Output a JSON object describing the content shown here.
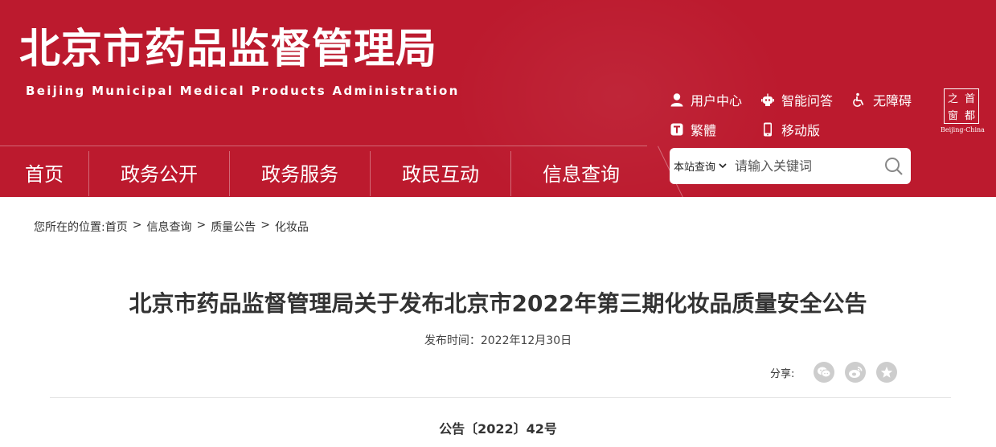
{
  "header": {
    "title": "北京市药品监督管理局",
    "subtitle": "Beijing Municipal Medical Products Administration",
    "links": [
      {
        "label": "用户中心",
        "icon": "user-icon"
      },
      {
        "label": "智能问答",
        "icon": "robot-icon"
      },
      {
        "label": "无障碍",
        "icon": "accessibility-icon"
      },
      {
        "label": "繁體",
        "icon": "traditional-chinese-icon"
      },
      {
        "label": "移动版",
        "icon": "mobile-icon"
      }
    ],
    "capital_logo": {
      "chars": [
        "之",
        "首",
        "窗",
        "都"
      ],
      "caption": "Beijing-China"
    }
  },
  "nav": {
    "items": [
      "首页",
      "政务公开",
      "政务服务",
      "政民互动",
      "信息查询"
    ]
  },
  "search": {
    "scope": "本站查询",
    "placeholder": "请输入关键词"
  },
  "breadcrumb": {
    "prefix": "您所在的位置:",
    "items": [
      "首页",
      "信息查询",
      "质量公告",
      "化妆品"
    ],
    "separator": ">"
  },
  "article": {
    "title": "北京市药品监督管理局关于发布北京市2022年第三期化妆品质量安全公告",
    "publish_time": "发布时间：2022年12月30日",
    "share_label": "分享:",
    "notice_number": "公告〔2022〕42号"
  },
  "colors": {
    "brand_red": "#bc1a2e",
    "share_icon_bg": "#cdcdcd"
  }
}
